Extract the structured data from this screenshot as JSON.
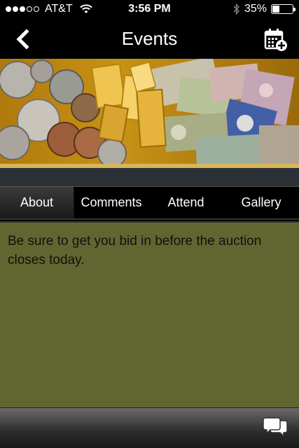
{
  "status_bar": {
    "carrier": "AT&T",
    "time": "3:56 PM",
    "battery_percent": "35%",
    "battery_level": 0.35,
    "signal_bars": 3,
    "icons": [
      "signal-dots-icon",
      "wifi-icon",
      "bluetooth-icon",
      "battery-icon"
    ]
  },
  "nav": {
    "title": "Events",
    "back_icon": "chevron-left-icon",
    "right_icon": "calendar-add-icon"
  },
  "banner": {
    "image": "coins-gold-bars-banknotes-banner"
  },
  "tabs": [
    {
      "label": "About",
      "selected": true
    },
    {
      "label": "Comments",
      "selected": false
    },
    {
      "label": "Attend",
      "selected": false
    },
    {
      "label": "Gallery",
      "selected": false
    }
  ],
  "content": {
    "text": "Be sure to get you bid in before the auction closes today."
  },
  "bottom_bar": {
    "icon": "chat-bubbles-icon"
  },
  "colors": {
    "content_bg": "#61652f",
    "banner_gold": "#c89216",
    "nav_bg": "#000000"
  }
}
